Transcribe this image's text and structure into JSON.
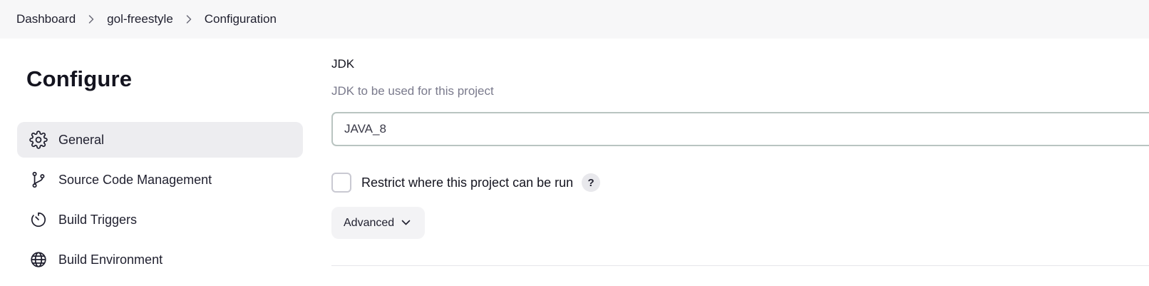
{
  "breadcrumb": {
    "items": [
      "Dashboard",
      "gol-freestyle",
      "Configuration"
    ]
  },
  "page": {
    "title": "Configure"
  },
  "sidebar": {
    "items": [
      {
        "label": "General",
        "icon": "gear-icon",
        "active": true
      },
      {
        "label": "Source Code Management",
        "icon": "branch-icon",
        "active": false
      },
      {
        "label": "Build Triggers",
        "icon": "timer-icon",
        "active": false
      },
      {
        "label": "Build Environment",
        "icon": "globe-icon",
        "active": false
      }
    ]
  },
  "jdk": {
    "title": "JDK",
    "description": "JDK to be used for this project",
    "selected": "JAVA_8"
  },
  "restrict": {
    "label": "Restrict where this project can be run",
    "checked": false,
    "help": "?"
  },
  "advanced": {
    "label": "Advanced"
  }
}
